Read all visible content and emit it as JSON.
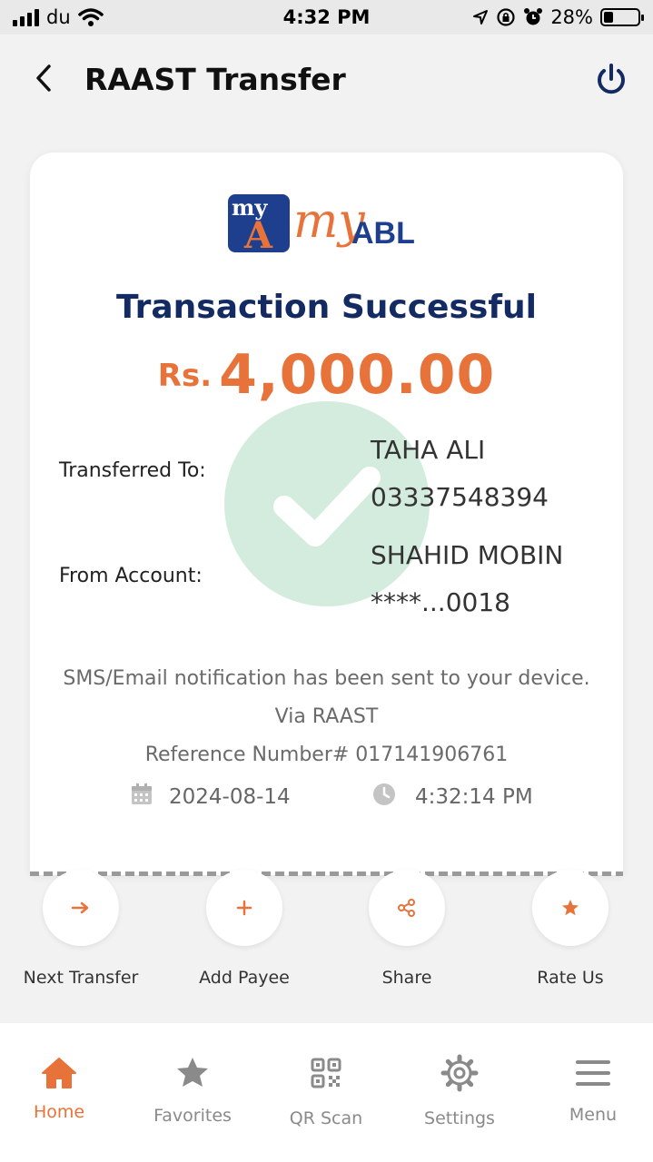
{
  "status_bar": {
    "carrier": "du",
    "time": "4:32 PM",
    "battery": "28%"
  },
  "header": {
    "title": "RAAST Transfer"
  },
  "logo": {
    "box_my": "my",
    "box_a": "A",
    "my": "my",
    "abl": "ABL"
  },
  "receipt": {
    "status": "Transaction Successful",
    "currency": "Rs.",
    "amount": "4,000.00",
    "transferred_to_label": "Transferred To:",
    "payee_name": "TAHA ALI",
    "payee_account": "03337548394",
    "from_account_label": "From Account:",
    "sender_name": "SHAHID MOBIN",
    "sender_account": "****...0018",
    "notification": "SMS/Email notification has been sent to your device.",
    "via": "Via RAAST",
    "reference": "Reference Number# 017141906761",
    "date": "2024-08-14",
    "time": "4:32:14 PM"
  },
  "actions": [
    {
      "label": "Next Transfer",
      "icon": "arrow-right-icon"
    },
    {
      "label": "Add Payee",
      "icon": "plus-icon"
    },
    {
      "label": "Share",
      "icon": "share-icon"
    },
    {
      "label": "Rate Us",
      "icon": "star-icon"
    }
  ],
  "bottom_nav": [
    {
      "label": "Home",
      "icon": "home-icon",
      "active": true
    },
    {
      "label": "Favorites",
      "icon": "star-icon",
      "active": false
    },
    {
      "label": "QR Scan",
      "icon": "qr-icon",
      "active": false
    },
    {
      "label": "Settings",
      "icon": "gear-icon",
      "active": false
    },
    {
      "label": "Menu",
      "icon": "hamburger-icon",
      "active": false
    }
  ],
  "colors": {
    "accent": "#e8733a",
    "navy": "#132a62",
    "success_circle": "#b8e0c8"
  }
}
